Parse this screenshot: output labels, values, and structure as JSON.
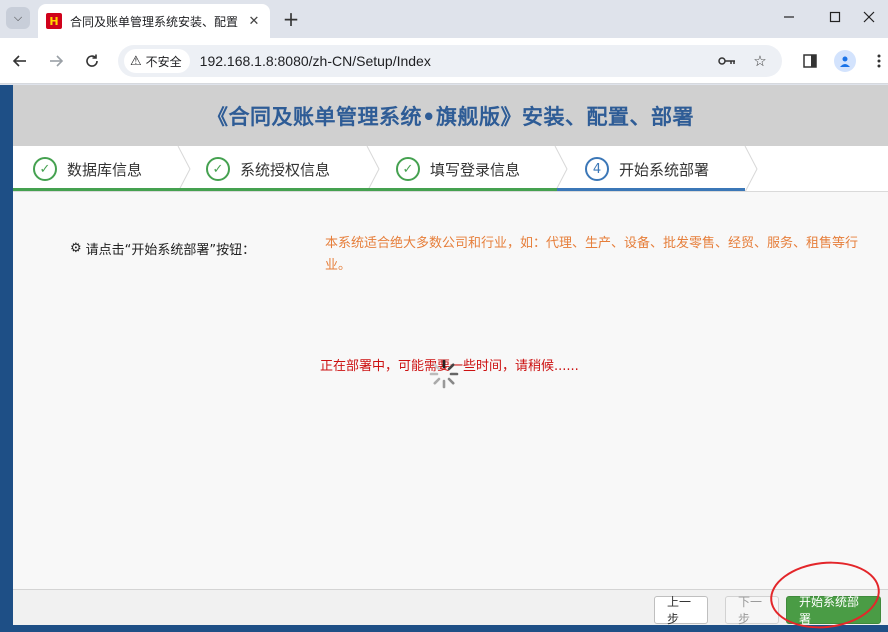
{
  "browser": {
    "tab": {
      "title": "合同及账单管理系统安装、配置",
      "favicon_text": "H"
    },
    "new_tab_symbol": "+",
    "security_label": "不安全",
    "url": "192.168.1.8:8080/zh-CN/Setup/Index"
  },
  "page": {
    "header_title": "《合同及账单管理系统•旗舰版》安装、配置、部署",
    "steps": [
      {
        "label": "数据库信息",
        "state": "done",
        "marker": "✓"
      },
      {
        "label": "系统授权信息",
        "state": "done",
        "marker": "✓"
      },
      {
        "label": "填写登录信息",
        "state": "done",
        "marker": "✓"
      },
      {
        "label": "开始系统部署",
        "state": "current",
        "marker": "4"
      }
    ],
    "prompt": "请点击“开始系统部署”按钮：",
    "notice": "本系统适合绝大多数公司和行业，如：代理、生产、设备、批发零售、经贸、服务、租售等行业。",
    "status": "正在部署中，可能需要一些时间，请稍候......",
    "buttons": {
      "prev": "上一步",
      "next": "下一步",
      "start": "开始系统部署"
    }
  },
  "colors": {
    "title_blue": "#2e5c96",
    "done_green": "#45a150",
    "current_blue": "#3b77b7",
    "notice_orange": "#e67e3a",
    "status_red": "#cc1111",
    "start_green": "#4a9c45",
    "annotation_red": "#e3262a"
  }
}
